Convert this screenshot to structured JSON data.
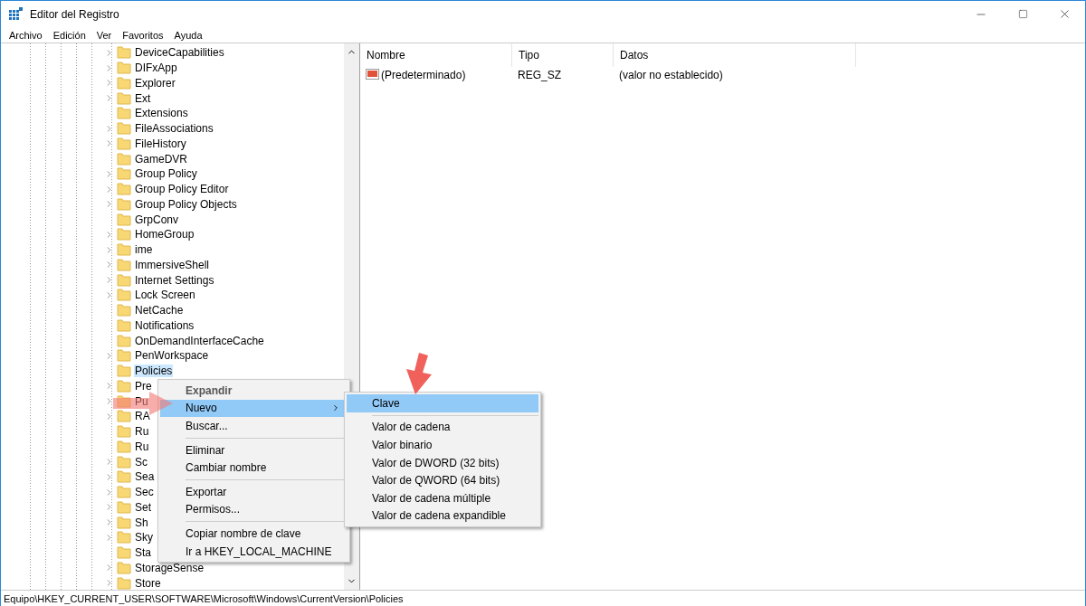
{
  "window": {
    "title": "Editor del Registro"
  },
  "menu_bar": [
    "Archivo",
    "Edición",
    "Ver",
    "Favoritos",
    "Ayuda"
  ],
  "tree": {
    "items": [
      {
        "label": "DeviceCapabilities",
        "expandable": true,
        "selected": false
      },
      {
        "label": "DIFxApp",
        "expandable": true,
        "selected": false
      },
      {
        "label": "Explorer",
        "expandable": true,
        "selected": false
      },
      {
        "label": "Ext",
        "expandable": true,
        "selected": false
      },
      {
        "label": "Extensions",
        "expandable": false,
        "selected": false
      },
      {
        "label": "FileAssociations",
        "expandable": true,
        "selected": false
      },
      {
        "label": "FileHistory",
        "expandable": true,
        "selected": false
      },
      {
        "label": "GameDVR",
        "expandable": false,
        "selected": false
      },
      {
        "label": "Group Policy",
        "expandable": true,
        "selected": false
      },
      {
        "label": "Group Policy Editor",
        "expandable": true,
        "selected": false
      },
      {
        "label": "Group Policy Objects",
        "expandable": true,
        "selected": false
      },
      {
        "label": "GrpConv",
        "expandable": false,
        "selected": false
      },
      {
        "label": "HomeGroup",
        "expandable": true,
        "selected": false
      },
      {
        "label": "ime",
        "expandable": true,
        "selected": false
      },
      {
        "label": "ImmersiveShell",
        "expandable": true,
        "selected": false
      },
      {
        "label": "Internet Settings",
        "expandable": true,
        "selected": false
      },
      {
        "label": "Lock Screen",
        "expandable": true,
        "selected": false
      },
      {
        "label": "NetCache",
        "expandable": false,
        "selected": false
      },
      {
        "label": "Notifications",
        "expandable": false,
        "selected": false
      },
      {
        "label": "OnDemandInterfaceCache",
        "expandable": false,
        "selected": false
      },
      {
        "label": "PenWorkspace",
        "expandable": true,
        "selected": false
      },
      {
        "label": "Policies",
        "expandable": false,
        "selected": true
      },
      {
        "label": "Pre",
        "expandable": true,
        "selected": false
      },
      {
        "label": "Pu",
        "expandable": true,
        "selected": false
      },
      {
        "label": "RA",
        "expandable": true,
        "selected": false
      },
      {
        "label": "Ru",
        "expandable": false,
        "selected": false
      },
      {
        "label": "Ru",
        "expandable": false,
        "selected": false
      },
      {
        "label": "Sc",
        "expandable": true,
        "selected": false
      },
      {
        "label": "Sea",
        "expandable": true,
        "selected": false
      },
      {
        "label": "Sec",
        "expandable": true,
        "selected": false
      },
      {
        "label": "Set",
        "expandable": true,
        "selected": false
      },
      {
        "label": "Sh",
        "expandable": true,
        "selected": false
      },
      {
        "label": "Sky",
        "expandable": true,
        "selected": false
      },
      {
        "label": "Sta",
        "expandable": false,
        "selected": false
      },
      {
        "label": "StorageSense",
        "expandable": true,
        "selected": false
      },
      {
        "label": "Store",
        "expandable": true,
        "selected": false
      }
    ]
  },
  "values_table": {
    "columns": [
      "Nombre",
      "Tipo",
      "Datos"
    ],
    "rows": [
      {
        "name": "(Predeterminado)",
        "type": "REG_SZ",
        "data": "(valor no establecido)"
      }
    ]
  },
  "context_menu": {
    "items": [
      {
        "kind": "item",
        "label": "Expandir",
        "bold": true,
        "selected": false,
        "submenu": false
      },
      {
        "kind": "item",
        "label": "Nuevo",
        "bold": false,
        "selected": true,
        "submenu": true
      },
      {
        "kind": "item",
        "label": "Buscar...",
        "bold": false,
        "selected": false,
        "submenu": false
      },
      {
        "kind": "separator"
      },
      {
        "kind": "item",
        "label": "Eliminar",
        "bold": false,
        "selected": false,
        "submenu": false
      },
      {
        "kind": "item",
        "label": "Cambiar nombre",
        "bold": false,
        "selected": false,
        "submenu": false
      },
      {
        "kind": "separator"
      },
      {
        "kind": "item",
        "label": "Exportar",
        "bold": false,
        "selected": false,
        "submenu": false
      },
      {
        "kind": "item",
        "label": "Permisos...",
        "bold": false,
        "selected": false,
        "submenu": false
      },
      {
        "kind": "separator"
      },
      {
        "kind": "item",
        "label": "Copiar nombre de clave",
        "bold": false,
        "selected": false,
        "submenu": false
      },
      {
        "kind": "item",
        "label": "Ir a HKEY_LOCAL_MACHINE",
        "bold": false,
        "selected": false,
        "submenu": false
      }
    ]
  },
  "submenu": {
    "items": [
      {
        "kind": "item",
        "label": "Clave",
        "bold": false,
        "selected": true,
        "submenu": false
      },
      {
        "kind": "separator"
      },
      {
        "kind": "item",
        "label": "Valor de cadena",
        "bold": false,
        "selected": false,
        "submenu": false
      },
      {
        "kind": "item",
        "label": "Valor binario",
        "bold": false,
        "selected": false,
        "submenu": false
      },
      {
        "kind": "item",
        "label": "Valor de DWORD (32 bits)",
        "bold": false,
        "selected": false,
        "submenu": false
      },
      {
        "kind": "item",
        "label": "Valor de QWORD (64 bits)",
        "bold": false,
        "selected": false,
        "submenu": false
      },
      {
        "kind": "item",
        "label": "Valor de cadena múltiple",
        "bold": false,
        "selected": false,
        "submenu": false
      },
      {
        "kind": "item",
        "label": "Valor de cadena expandible",
        "bold": false,
        "selected": false,
        "submenu": false
      }
    ]
  },
  "status_bar": "Equipo\\HKEY_CURRENT_USER\\SOFTWARE\\Microsoft\\Windows\\CurrentVersion\\Policies"
}
